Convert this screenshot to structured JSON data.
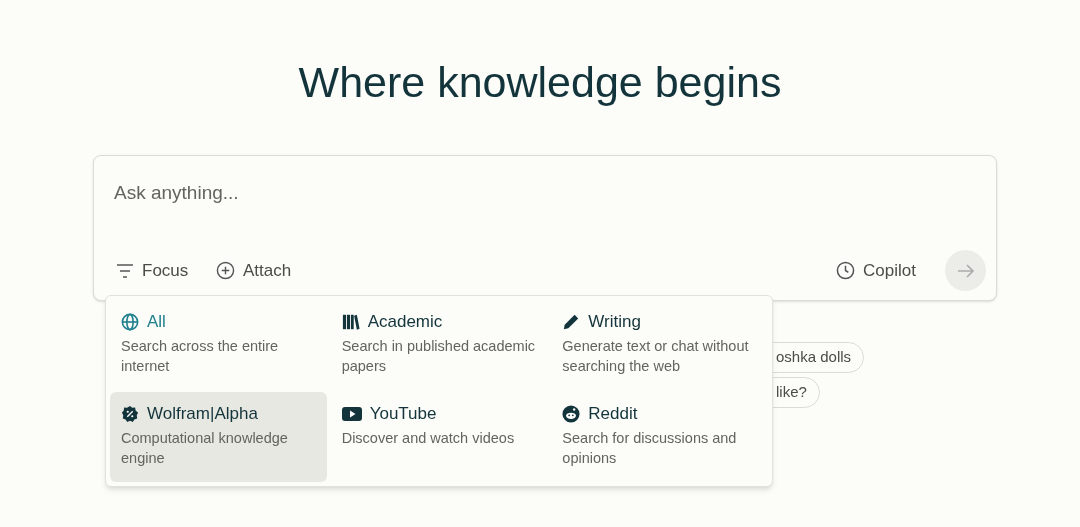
{
  "heading": "Where knowledge begins",
  "search": {
    "placeholder": "Ask anything...",
    "focus_label": "Focus",
    "attach_label": "Attach",
    "copilot_label": "Copilot",
    "copilot_on": false
  },
  "suggestions": [
    {
      "label": "oshka dolls"
    },
    {
      "label": "like?"
    }
  ],
  "focus_menu": [
    {
      "label": "All",
      "description": "Search across the entire internet",
      "selected": true,
      "highlighted": false
    },
    {
      "label": "Academic",
      "description": "Search in published academic papers",
      "selected": false,
      "highlighted": false
    },
    {
      "label": "Writing",
      "description": "Generate text or chat without searching the web",
      "selected": false,
      "highlighted": false
    },
    {
      "label": "Wolfram|Alpha",
      "description": "Computational knowledge engine",
      "selected": false,
      "highlighted": true
    },
    {
      "label": "YouTube",
      "description": "Discover and watch videos",
      "selected": false,
      "highlighted": false
    },
    {
      "label": "Reddit",
      "description": "Search for discussions and opinions",
      "selected": false,
      "highlighted": false
    }
  ]
}
